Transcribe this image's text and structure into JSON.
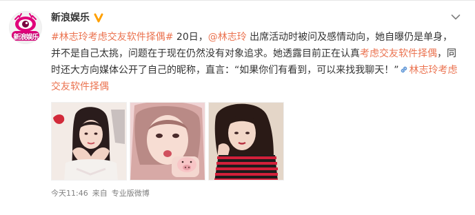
{
  "account": {
    "name": "新浪娱乐",
    "avatar_text": "新浪娱乐"
  },
  "post": {
    "lines": [
      [
        {
          "text": "#林志玲考虑交友软件择偶#",
          "type": "link"
        },
        {
          "text": " 20日，",
          "type": "text"
        },
        {
          "text": "@林志玲",
          "type": "link"
        },
        {
          "text": " 出席活动时被问及感情动向，她自曝仍是单身，",
          "type": "text"
        }
      ],
      [
        {
          "text": "并不是自己太挑，问题在于现在仍然没有对象追求。她透露目前正在认真",
          "type": "text"
        },
        {
          "text": "考虑交友软件择偶",
          "type": "link"
        },
        {
          "text": "，同",
          "type": "text"
        }
      ],
      [
        {
          "text": "时还大方向媒体公开了自己的昵称，直言：“如果你们有看到，可以来找我聊天！”",
          "type": "text"
        },
        {
          "text": "林志玲考虑",
          "type": "link-icon"
        }
      ],
      [
        {
          "text": "交友软件择偶",
          "type": "link"
        }
      ]
    ]
  },
  "meta": {
    "time": "今天11:46",
    "from_label": "来自",
    "source": "专业版微博"
  },
  "photos": [
    {
      "name": "photo-1"
    },
    {
      "name": "photo-2"
    },
    {
      "name": "photo-3"
    }
  ],
  "colors": {
    "link": "#eb7350",
    "verified": "#ffa000",
    "meta": "#808080",
    "text": "#333333"
  },
  "icons": {
    "verified": "verified-badge-icon",
    "chevron": "chevron-down-icon",
    "link": "link-icon"
  }
}
